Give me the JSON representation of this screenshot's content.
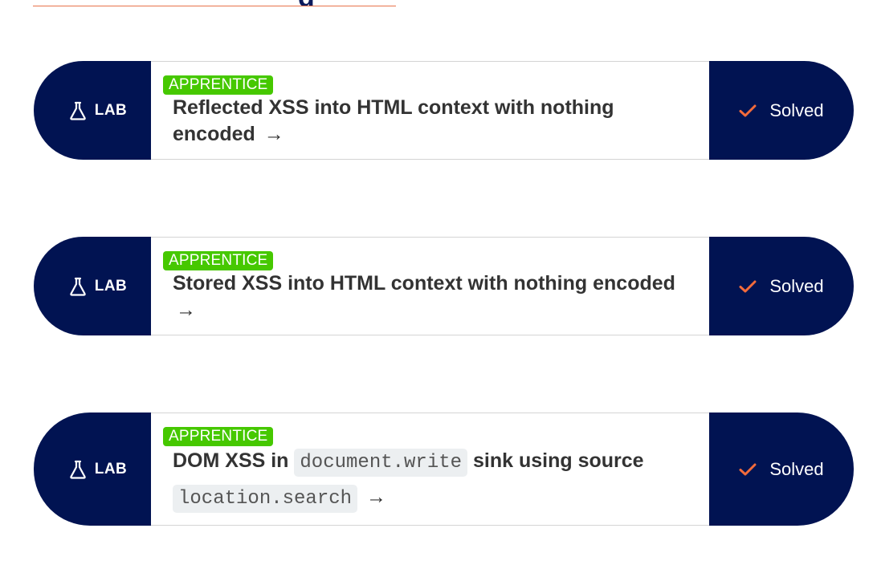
{
  "heading": {
    "visible_fragment": "g"
  },
  "labs": [
    {
      "kind_label": "LAB",
      "level": "APPRENTICE",
      "title_segments": [
        {
          "type": "text",
          "value": "Reflected XSS into HTML context with nothing encoded"
        }
      ],
      "arrow": "→",
      "status": "Solved"
    },
    {
      "kind_label": "LAB",
      "level": "APPRENTICE",
      "title_segments": [
        {
          "type": "text",
          "value": "Stored XSS into HTML context with nothing encoded"
        }
      ],
      "arrow": "→",
      "status": "Solved"
    },
    {
      "kind_label": "LAB",
      "level": "APPRENTICE",
      "title_segments": [
        {
          "type": "text",
          "value": "DOM XSS in "
        },
        {
          "type": "code",
          "value": "document.write"
        },
        {
          "type": "text",
          "value": " sink using source "
        },
        {
          "type": "code",
          "value": "location.search"
        }
      ],
      "arrow": "→",
      "status": "Solved"
    }
  ],
  "colors": {
    "navy": "#011352",
    "apprentice_green": "#46c800",
    "check_orange": "#f36b3b",
    "title_text": "#333333"
  },
  "icons": {
    "lab": "flask-icon",
    "status": "checkmark-icon"
  }
}
